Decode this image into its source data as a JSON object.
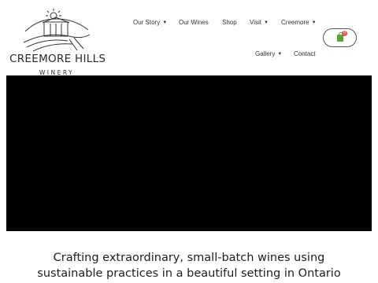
{
  "logo": {
    "name": "CREEMORE HILLS",
    "subtitle": "WINERY",
    "icon": "barn-hills-sun-logo"
  },
  "nav": {
    "items": [
      {
        "label": "Our Story",
        "has_dropdown": true
      },
      {
        "label": "Our Wines",
        "has_dropdown": false
      },
      {
        "label": "Shop",
        "has_dropdown": false
      },
      {
        "label": "Visit",
        "has_dropdown": true
      },
      {
        "label": "Creemore",
        "has_dropdown": true
      },
      {
        "label": "Gallery",
        "has_dropdown": true
      },
      {
        "label": "Contact",
        "has_dropdown": false
      }
    ],
    "caret": "▼"
  },
  "cart": {
    "icon": "shopping-bag-icon",
    "count": "0",
    "accent_color": "#5aa03b",
    "badge_color": "#d9534f"
  },
  "hero": {
    "background_color": "#000000"
  },
  "tagline": {
    "line1": "Crafting extraordinary, small-batch wines using",
    "line2": "sustainable practices in a beautiful setting in Ontario"
  }
}
